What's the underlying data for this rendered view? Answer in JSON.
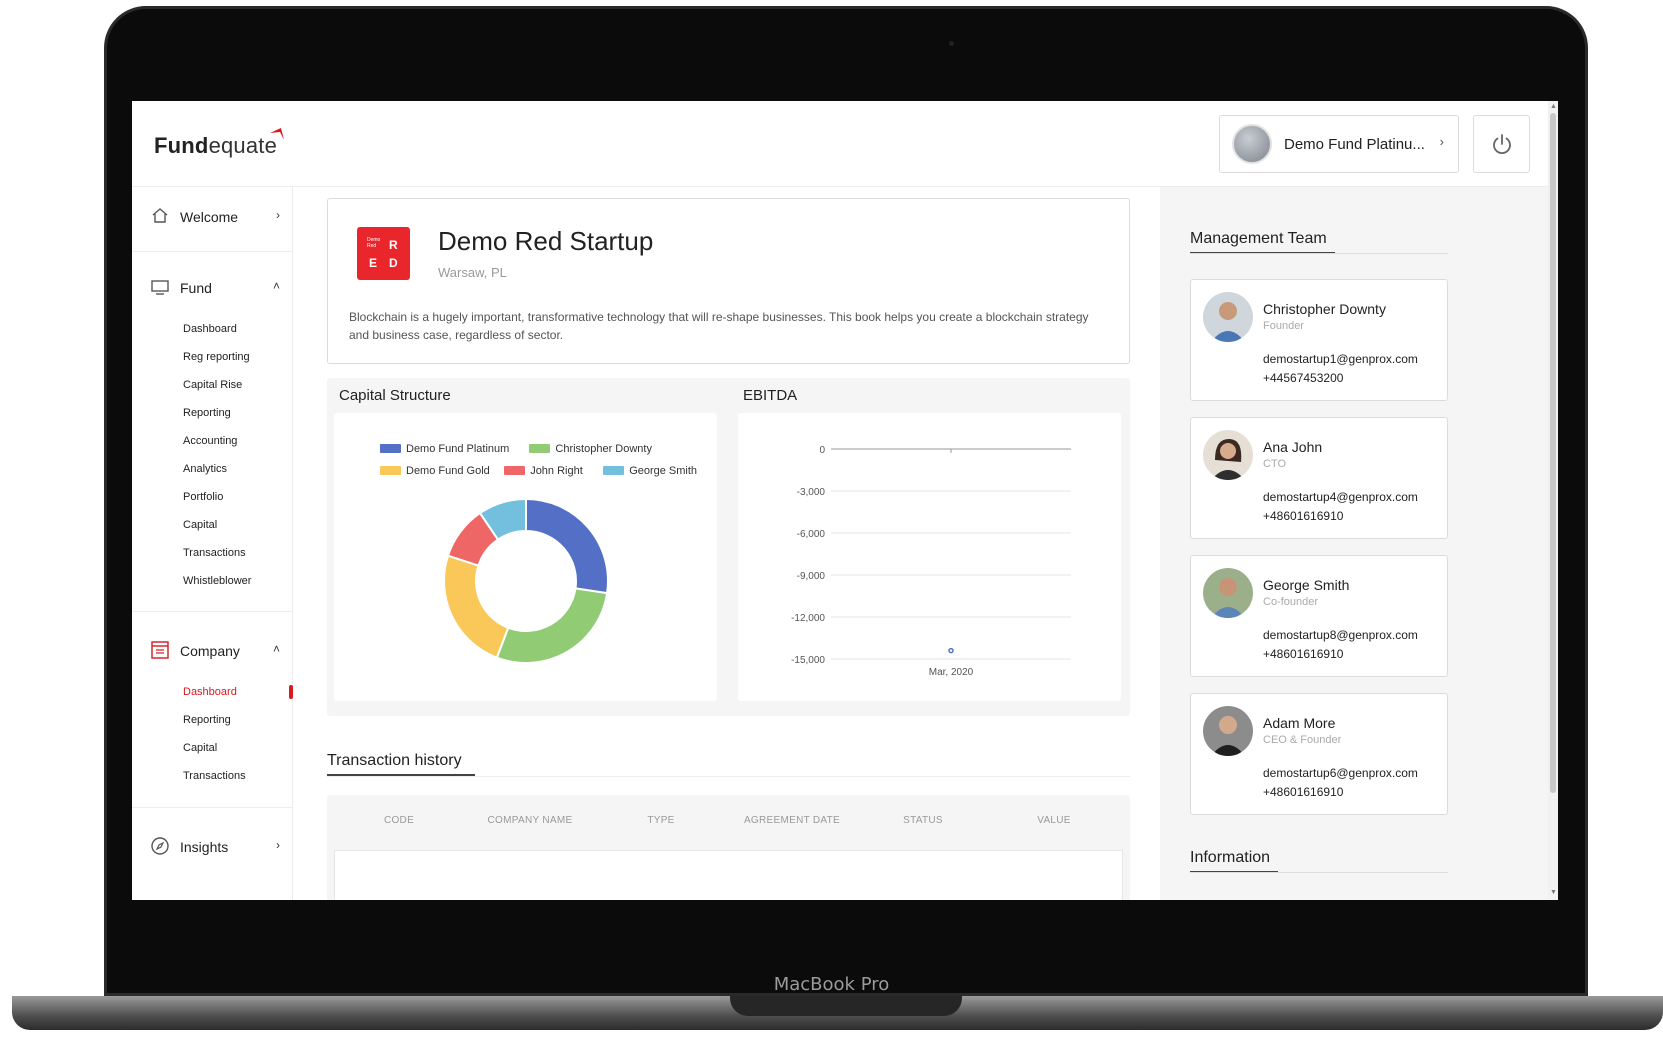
{
  "device": {
    "label": "MacBook Pro"
  },
  "header": {
    "logo_bold": "Fund",
    "logo_light": "equate",
    "fund_selector": "Demo Fund Platinu...",
    "fund_chevron": "›"
  },
  "sidebar": {
    "welcome": {
      "label": "Welcome",
      "chevron": "›",
      "icon": "home-icon"
    },
    "fund": {
      "label": "Fund",
      "chevron": "˄",
      "icon": "monitor-icon",
      "items": [
        "Dashboard",
        "Reg reporting",
        "Capital Rise",
        "Reporting",
        "Accounting",
        "Analytics",
        "Portfolio",
        "Capital",
        "Transactions",
        "Whistleblower"
      ]
    },
    "company": {
      "label": "Company",
      "chevron": "˄",
      "icon": "building-icon",
      "items": [
        "Dashboard",
        "Reporting",
        "Capital",
        "Transactions"
      ],
      "active_index": 0
    },
    "insights": {
      "label": "Insights",
      "chevron": "›",
      "icon": "compass-icon"
    }
  },
  "company": {
    "logo_small_text": "Demo\nRed",
    "logo_letters": [
      "R",
      "E",
      "D"
    ],
    "name": "Demo Red Startup",
    "location": "Warsaw, PL",
    "description": "Blockchain is a hugely important, transformative technology that will re-shape businesses. This book helps you create a blockchain strategy and business case, regardless of sector."
  },
  "chart_data": [
    {
      "type": "pie",
      "title": "Capital Structure",
      "donut": true,
      "legend_position": "top",
      "series": [
        {
          "name": "Demo Fund Platinum",
          "value": 26,
          "color": "#5470c6"
        },
        {
          "name": "Christopher Downty",
          "value": 27,
          "color": "#91cc75"
        },
        {
          "name": "Demo Fund Gold",
          "value": 23,
          "color": "#fac858"
        },
        {
          "name": "John Right",
          "value": 10,
          "color": "#ee6666"
        },
        {
          "name": "George Smith",
          "value": 9,
          "color": "#73c0de"
        }
      ]
    },
    {
      "type": "scatter",
      "title": "EBITDA",
      "x": [
        "Mar, 2020"
      ],
      "y": [
        -14400
      ],
      "color": "#5470c6",
      "ylim": [
        -15000,
        0
      ],
      "yticks": [
        "0",
        "-3,000",
        "-6,000",
        "-9,000",
        "-12,000",
        "-15,000"
      ],
      "ytick_values": [
        0,
        -3000,
        -6000,
        -9000,
        -12000,
        -15000
      ],
      "grid": true
    }
  ],
  "transactions": {
    "title": "Transaction history",
    "columns": [
      "CODE",
      "COMPANY NAME",
      "TYPE",
      "AGREEMENT DATE",
      "STATUS",
      "VALUE"
    ]
  },
  "management": {
    "title": "Management Team",
    "members": [
      {
        "name": "Christopher Downty",
        "role": "Founder",
        "email": "demostartup1@genprox.com",
        "phone": "+44567453200"
      },
      {
        "name": "Ana John",
        "role": "CTO",
        "email": "demostartup4@genprox.com",
        "phone": "+48601616910"
      },
      {
        "name": "George Smith",
        "role": "Co-founder",
        "email": "demostartup8@genprox.com",
        "phone": "+48601616910"
      },
      {
        "name": "Adam More",
        "role": "CEO & Founder",
        "email": "demostartup6@genprox.com",
        "phone": "+48601616910"
      }
    ]
  },
  "information": {
    "title": "Information"
  },
  "colors": {
    "accent_red": "#d71920",
    "logo_red": "#e8262b"
  }
}
